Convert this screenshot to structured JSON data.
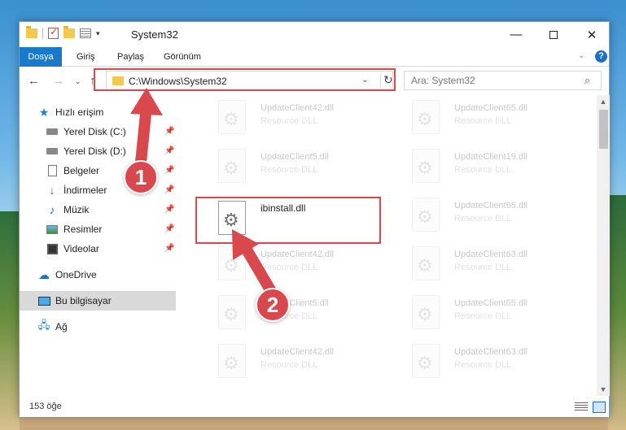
{
  "titlebar": {
    "title": "System32",
    "minimize": "—",
    "close": "✕"
  },
  "ribbon": {
    "tabs": [
      "Dosya",
      "Giriş",
      "Paylaş",
      "Görünüm"
    ],
    "help": "?"
  },
  "address": {
    "path": "C:\\Windows\\System32",
    "refresh": "↻",
    "dropdown": "⌄"
  },
  "search": {
    "placeholder": "Ara: System32"
  },
  "sidebar": {
    "items": [
      {
        "label": "Hızlı erişim",
        "icon": "star-icon"
      },
      {
        "label": "Yerel Disk (C:)",
        "icon": "disk-icon"
      },
      {
        "label": "Yerel Disk (D:)",
        "icon": "disk-icon"
      },
      {
        "label": "Belgeler",
        "icon": "document-icon"
      },
      {
        "label": "İndirmeler",
        "icon": "download-icon"
      },
      {
        "label": "Müzik",
        "icon": "music-icon"
      },
      {
        "label": "Resimler",
        "icon": "pictures-icon"
      },
      {
        "label": "Videolar",
        "icon": "video-icon"
      },
      {
        "label": "OneDrive",
        "icon": "cloud-icon"
      },
      {
        "label": "Bu bilgisayar",
        "icon": "computer-icon"
      },
      {
        "label": "Ağ",
        "icon": "network-icon"
      }
    ]
  },
  "files": {
    "col1": [
      {
        "name": "UpdateClient42.dll",
        "type": "Resource DLL"
      },
      {
        "name": "UpdateClient5.dll",
        "type": "Resource DLL"
      },
      {
        "name": "ibinstall.dll",
        "type": ""
      },
      {
        "name": "UpdateClient42.dll",
        "type": "Resource DLL"
      },
      {
        "name": "UpdateClient5.dll",
        "type": "Resource DLL"
      },
      {
        "name": "UpdateClient42.dll",
        "type": "Resource DLL"
      }
    ],
    "col2": [
      {
        "name": "UpdateClient65.dll",
        "type": "Resource DLL"
      },
      {
        "name": "UpdateClient19.dll",
        "type": "Resource DLL"
      },
      {
        "name": "UpdateClient65.dll",
        "type": "Resource DLL"
      },
      {
        "name": "UpdateClient63.dll",
        "type": "Resource DLL"
      },
      {
        "name": "UpdateClient65.dll",
        "type": "Resource DLL"
      },
      {
        "name": "UpdateClient63.dll",
        "type": "Resource DLL"
      }
    ]
  },
  "status": {
    "count": "153 öğe"
  },
  "annotations": {
    "step1": "1",
    "step2": "2",
    "color": "#d9484d"
  }
}
